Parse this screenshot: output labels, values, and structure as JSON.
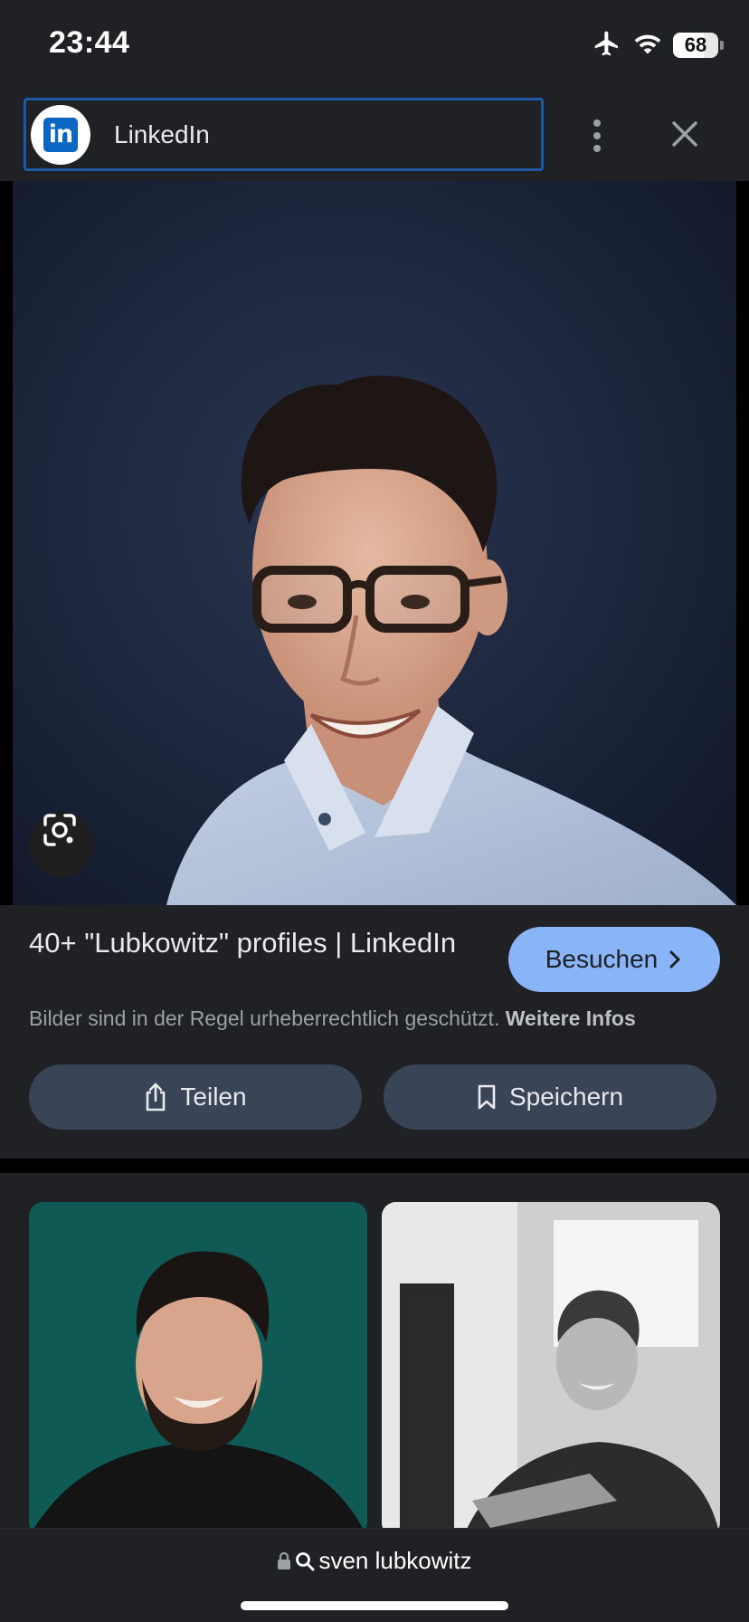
{
  "status_bar": {
    "time": "23:44",
    "battery_level": "68",
    "icons": [
      "airplane-icon",
      "wifi-icon",
      "battery-icon"
    ]
  },
  "header": {
    "source_name": "LinkedIn",
    "source_logo_text": "in",
    "more_icon": "more-vert-icon",
    "close_icon": "close-icon"
  },
  "result": {
    "title": "40+ \"Lubkowitz\" profiles | LinkedIn",
    "visit_label": "Besuchen",
    "copyright_text": "Bilder sind in der Regel urheberrechtlich geschützt.",
    "more_info_link": "Weitere Infos",
    "share_label": "Teilen",
    "save_label": "Speichern"
  },
  "bottom_bar": {
    "address_text": "sven lubkowitz"
  },
  "colors": {
    "background": "#202124",
    "accent_button": "#8ab4f8",
    "action_button": "#394457",
    "source_border": "#1c5aa6",
    "linkedin_blue": "#0a66c2"
  }
}
